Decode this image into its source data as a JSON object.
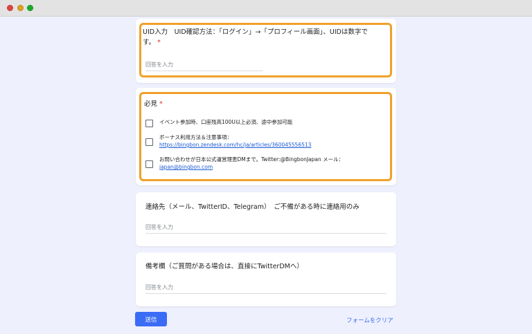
{
  "form": {
    "q1": {
      "title": "UID入力　UID確認方法：「ログイン」→「プロフィール画面」、UIDは数字で",
      "title_cont": "す。",
      "required_mark": "*",
      "placeholder": "回答を入力"
    },
    "q2": {
      "title": "必見",
      "required_mark": "*",
      "options": [
        {
          "text": "イベント参加時、口座残高100U以上必須、途中参加可能",
          "link": ""
        },
        {
          "text": "ボーナス利用方法＆注意事項：",
          "link": "https://bingbon.zendesk.com/hc/ja/articles/360045556513"
        },
        {
          "text": "お問い合わせが日本公式運営理恵DMまで。Twitter:@BingbonJapan メール：",
          "link": "japan@bingbon.com"
        }
      ]
    },
    "q3": {
      "title": "連絡先（メール、TwitterID、Telegram）　ご不備がある時に連絡用のみ",
      "placeholder": "回答を入力"
    },
    "q4": {
      "title": "備考欄（ご質問がある場合は、直接にTwitterDMへ）",
      "placeholder": "回答を入力"
    },
    "submit_label": "送信",
    "clear_label": "フォームをクリア"
  },
  "colors": {
    "accent": "#3b6cf5",
    "highlight": "#f0a02a",
    "required": "#d93025",
    "background": "#eef0fd"
  }
}
